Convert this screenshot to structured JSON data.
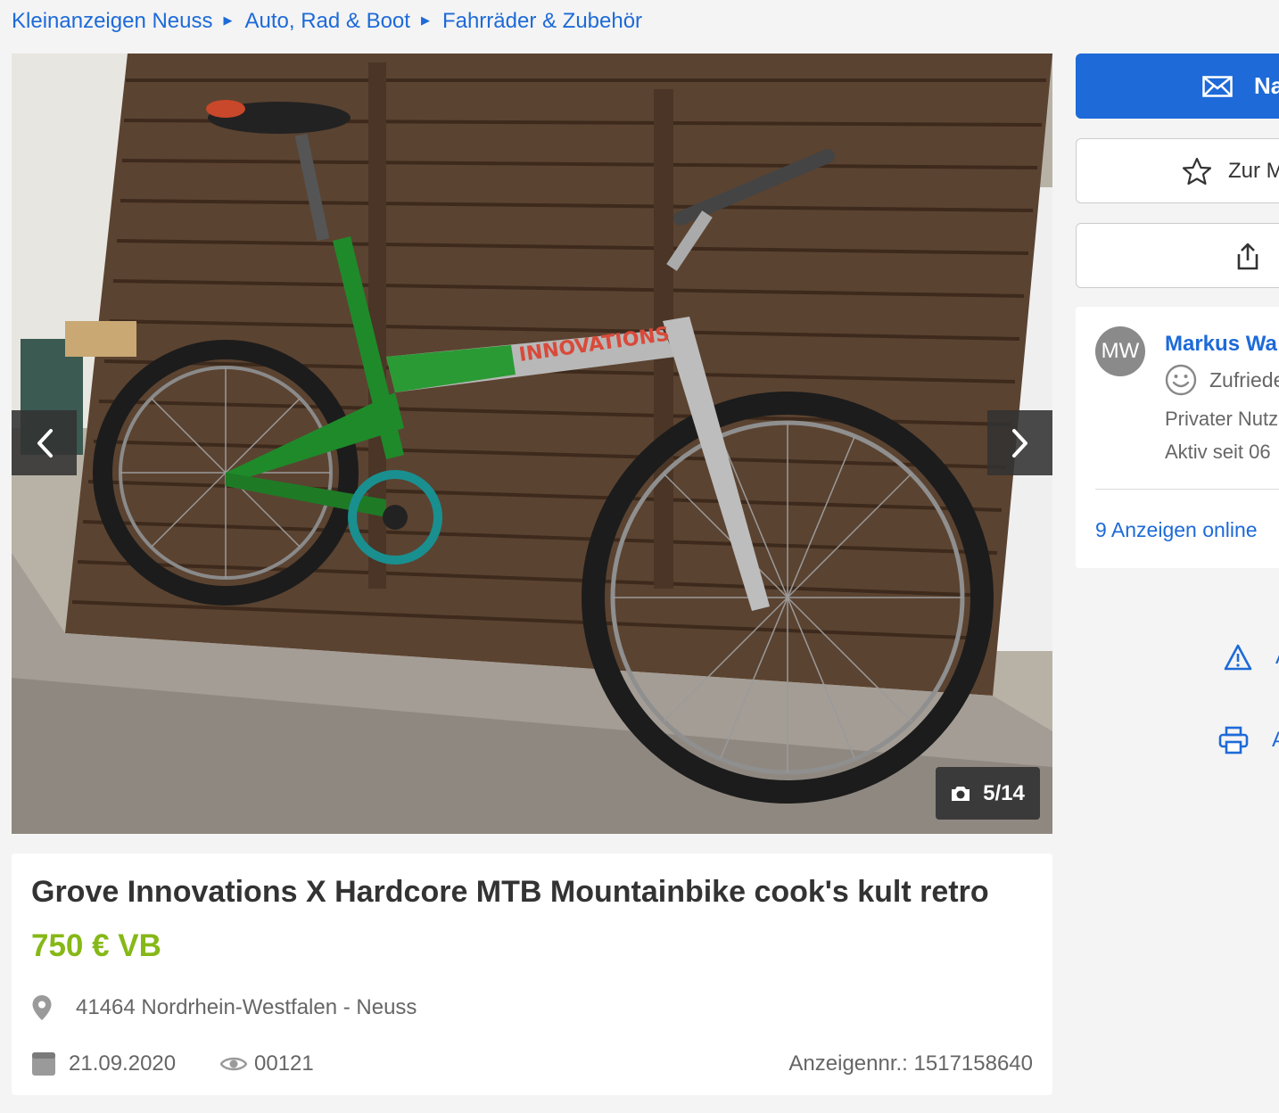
{
  "breadcrumb": [
    {
      "label": "Kleinanzeigen Neuss"
    },
    {
      "label": "Auto, Rad & Boot"
    },
    {
      "label": "Fahrräder & Zubehör"
    }
  ],
  "gallery": {
    "counter": "5/14",
    "current_image": 5,
    "total_images": 14,
    "frame_text": "INNOVATIONS"
  },
  "listing": {
    "title": "Grove Innovations X Hardcore MTB Mountainbike cook's kult retro",
    "price": "750 € VB",
    "location": "41464 Nordrhein-Westfalen - Neuss",
    "date": "21.09.2020",
    "views": "00121",
    "ad_id": "Anzeigennr.: 1517158640"
  },
  "sidebar": {
    "contact_label": "Na",
    "watch_label": "Zur M",
    "seller": {
      "initials": "MW",
      "name": "Markus Wa",
      "satisfaction": "Zufriede",
      "type": "Privater Nutz",
      "active_since": "Aktiv seit 06",
      "ads_online": "9 Anzeigen online"
    },
    "report_label": "A",
    "print_label": "A"
  },
  "colors": {
    "link_blue": "#1d6ad8",
    "price_green": "#86b817",
    "background": "#f4f4f4"
  },
  "icons": {
    "prev": "chevron-left-icon",
    "next": "chevron-right-icon",
    "camera": "camera-icon",
    "mail": "mail-icon",
    "star": "star-icon",
    "share": "share-icon",
    "pin": "location-pin-icon",
    "calendar": "calendar-icon",
    "eye": "eye-icon",
    "smiley": "smiley-icon",
    "warning": "warning-icon",
    "print": "printer-icon"
  }
}
